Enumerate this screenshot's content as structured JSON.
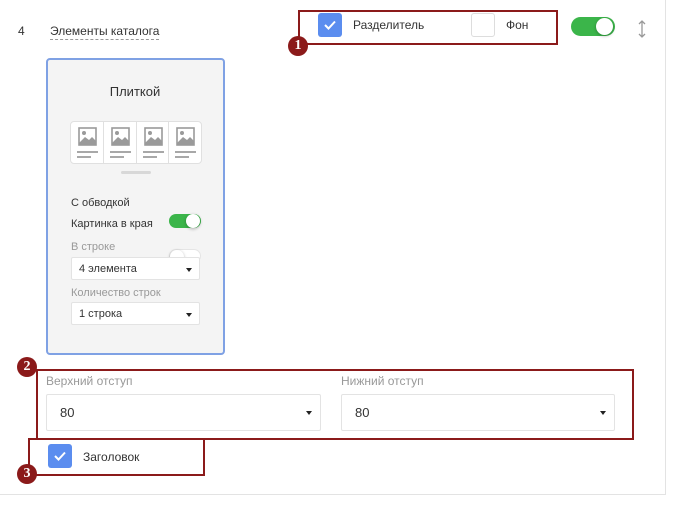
{
  "row": {
    "number": "4",
    "title": "Элементы каталога",
    "enabled": true
  },
  "header_options": {
    "divider_label": "Разделитель",
    "divider_checked": true,
    "background_label": "Фон",
    "background_checked": false
  },
  "card": {
    "title": "Плиткой",
    "tile_icons": [
      "image-icon",
      "image-icon",
      "image-icon",
      "image-icon"
    ],
    "bordered_label": "С обводкой",
    "bordered_on": true,
    "edge_image_label": "Картинка в края",
    "edge_image_on": false,
    "per_row_label": "В строке",
    "per_row_value": "4 элемента",
    "rows_count_label": "Количество строк",
    "rows_count_value": "1 строка"
  },
  "padding": {
    "top_label": "Верхний отступ",
    "top_value": "80",
    "bottom_label": "Нижний отступ",
    "bottom_value": "80"
  },
  "heading": {
    "label": "Заголовок",
    "checked": true
  },
  "annotations": {
    "marker_1": "1",
    "marker_2": "2",
    "marker_3": "3",
    "color": "#8b1a1a"
  },
  "colors": {
    "accent_blue": "#5b8def",
    "toggle_green": "#3bb54a",
    "card_border": "#7fa1e4"
  }
}
